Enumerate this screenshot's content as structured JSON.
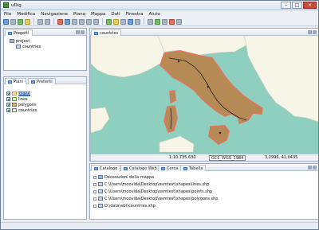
{
  "window": {
    "title": "uDig"
  },
  "menu": [
    "File",
    "Modifica",
    "Navigazione",
    "Piano",
    "Mappa",
    "Dati",
    "Finestra",
    "Aiuto"
  ],
  "projects_panel": {
    "tab": "Progetti",
    "project": "project",
    "map": "countries"
  },
  "layers_panel": {
    "tabs": [
      "Piani",
      "Preferiti"
    ],
    "layers": [
      {
        "name": "points",
        "selected": true
      },
      {
        "name": "lines",
        "selected": false
      },
      {
        "name": "polygons",
        "selected": false
      },
      {
        "name": "countries",
        "selected": false
      }
    ]
  },
  "map_editor": {
    "tab": "countries",
    "scale": "1:10.735.630",
    "crs": "GCS_WGS_1984",
    "coords": "3,2996, 41,0435"
  },
  "bottom_panel": {
    "tabs": [
      "Catalogo",
      "Catalogo Web",
      "Cerca",
      "Tabella"
    ],
    "items": [
      "Decorazioni della mappa",
      "C:\\Users\\moovida\\Desktop\\osmtest\\shapes\\lines.shp",
      "C:\\Users\\moovida\\Desktop\\osmtest\\shapes\\points.shp",
      "C:\\Users\\moovida\\Desktop\\osmtest\\shapes\\polygons.shp",
      "D:\\data\\abt\\countries.shp"
    ]
  },
  "colors": {
    "sea": "#8fcfbf",
    "land": "#f7f5e8",
    "italy": "#b58a55",
    "outline": "#e1745c"
  }
}
